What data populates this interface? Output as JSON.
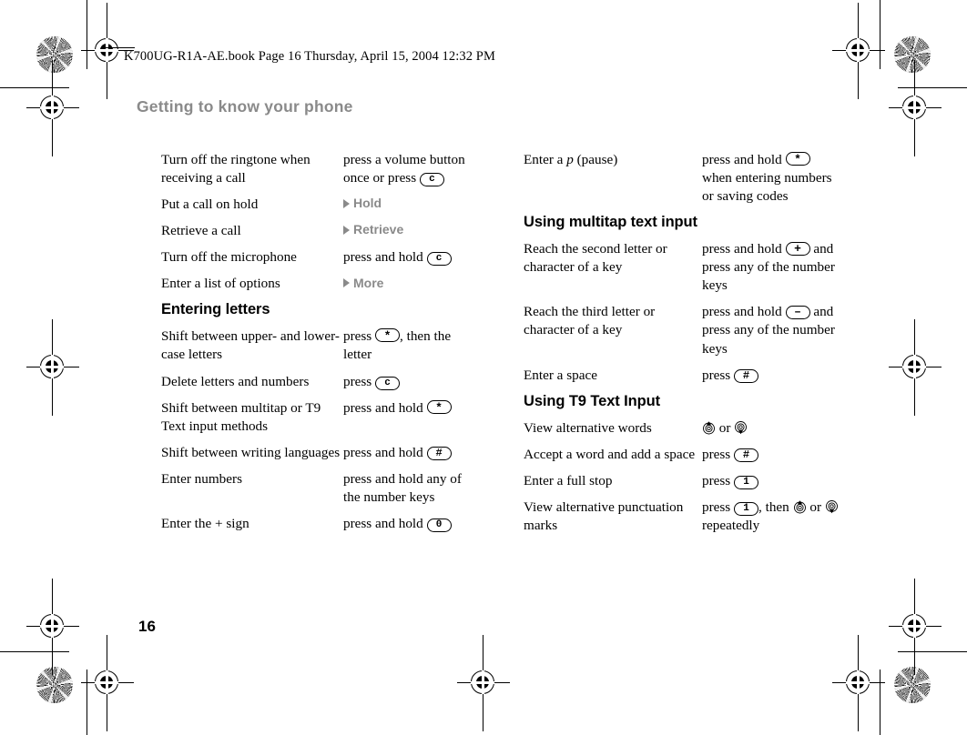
{
  "page": {
    "file_stamp": "K700UG-R1A-AE.book  Page 16  Thursday, April 15, 2004  12:32 PM",
    "running_head": "Getting to know your phone",
    "page_number": "16",
    "heading_color": "#8a8a8a",
    "menupath_color": "#8a8a8a",
    "body_color": "#000000"
  },
  "left_column": {
    "rows_top": [
      {
        "term": "Turn off the ringtone when receiving a call",
        "action_pre": "press a volume button once or press ",
        "key": "c",
        "action_post": ""
      },
      {
        "term": "Put a call on hold",
        "menupath": "Hold"
      },
      {
        "term": "Retrieve a call",
        "menupath": "Retrieve"
      },
      {
        "term": "Turn off the microphone",
        "action_pre": "press and hold ",
        "key": "c",
        "action_post": ""
      },
      {
        "term": "Enter a list of options",
        "menupath": "More"
      }
    ],
    "subhead": "Entering letters",
    "rows_bottom": [
      {
        "term": "Shift between upper- and lower-case letters",
        "action_pre": "press ",
        "key": "*",
        "action_post": ", then the letter"
      },
      {
        "term": "Delete letters and numbers",
        "action_pre": "press ",
        "key": "c",
        "action_post": ""
      },
      {
        "term": "Shift between multitap or T9 Text input methods",
        "action_pre": "press and hold ",
        "key": "*",
        "action_post": ""
      },
      {
        "term": "Shift between writing languages",
        "action_pre": "press and hold ",
        "key": "#",
        "action_post": ""
      },
      {
        "term": "Enter numbers",
        "action_pre": "press and hold any of the number keys",
        "key": "",
        "action_post": ""
      },
      {
        "term": "Enter the + sign",
        "action_pre": "press and hold ",
        "key": "0",
        "action_post": ""
      }
    ]
  },
  "right_column": {
    "rows_top": [
      {
        "term_pre": "Enter a ",
        "term_em": "p",
        "term_post": " (pause)",
        "action_pre": "press and hold ",
        "key": "*",
        "action_post": " when entering numbers or saving codes"
      }
    ],
    "subhead_multitap": "Using multitap text input",
    "rows_multitap": [
      {
        "term": "Reach the second letter or character of a key",
        "action_pre": "press and hold ",
        "key": "+",
        "action_post": " and press any of the number keys"
      },
      {
        "term": "Reach the third letter or character of a key",
        "action_pre": "press and hold ",
        "key": "–",
        "action_post": " and press any of the number keys"
      },
      {
        "term": "Enter a space",
        "action_pre": "press ",
        "key": "#",
        "action_post": ""
      }
    ],
    "subhead_t9": "Using T9 Text Input",
    "rows_t9": [
      {
        "term": "View alternative words",
        "nav_up": "nav-up-icon",
        "or_text": " or ",
        "nav_down": "nav-down-icon"
      },
      {
        "term": "Accept a word and add a space",
        "action_pre": "press ",
        "key": "#",
        "action_post": ""
      },
      {
        "term": "Enter a full stop",
        "action_pre": "press ",
        "key": "1",
        "action_post": ""
      },
      {
        "term": "View alternative punctuation marks",
        "action_pre": "press ",
        "key": "1",
        "action_mid": ", then ",
        "action_or": " or ",
        "action_post": " repeatedly"
      }
    ]
  }
}
